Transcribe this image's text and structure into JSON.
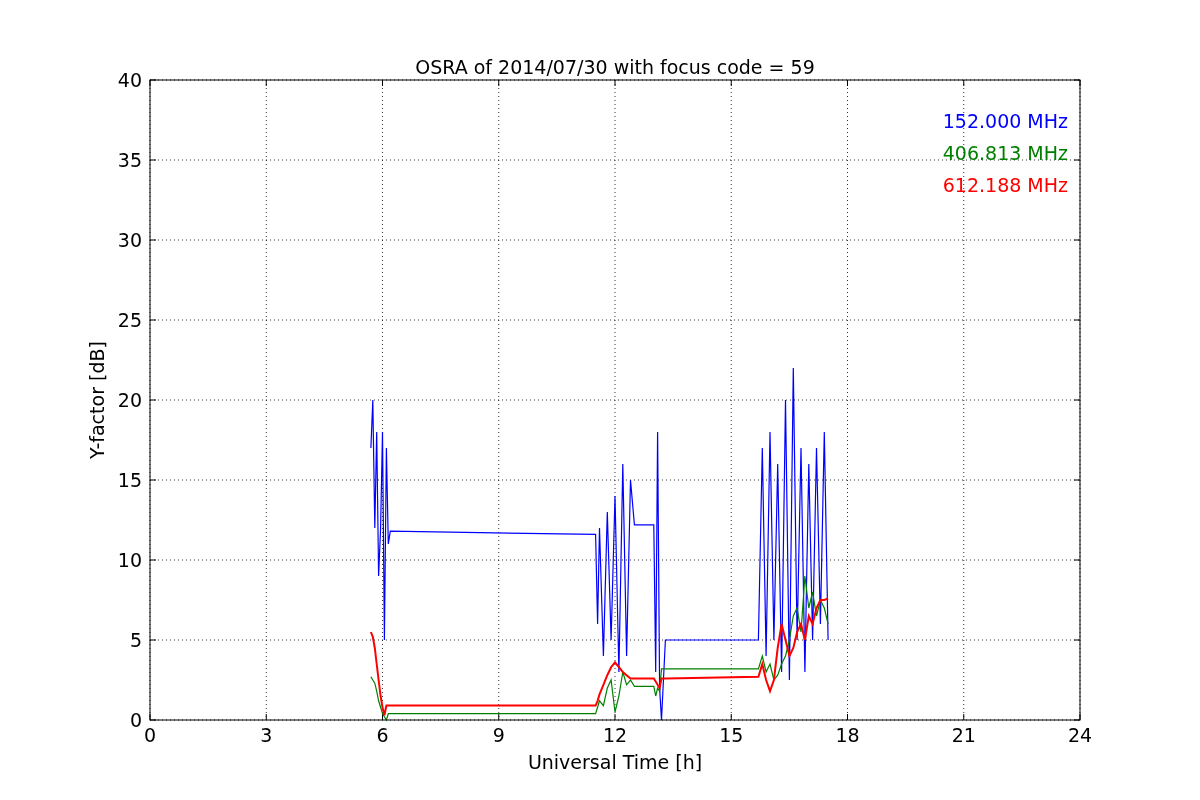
{
  "chart_data": {
    "type": "line",
    "title": "OSRA of 2014/07/30 with focus code = 59",
    "xlabel": "Universal Time [h]",
    "ylabel": "Y-factor [dB]",
    "x": [
      5.7,
      5.75,
      5.8,
      5.85,
      5.9,
      5.95,
      6.0,
      6.05,
      6.1,
      6.15,
      6.2,
      11.5,
      11.55,
      11.6,
      11.7,
      11.8,
      11.9,
      12.0,
      12.1,
      12.2,
      12.3,
      12.4,
      12.5,
      13.0,
      13.05,
      13.1,
      13.15,
      13.2,
      13.3,
      15.7,
      15.8,
      15.9,
      16.0,
      16.1,
      16.2,
      16.3,
      16.4,
      16.5,
      16.6,
      16.7,
      16.8,
      16.9,
      17.0,
      17.1,
      17.2,
      17.3,
      17.4,
      17.5
    ],
    "series": [
      {
        "name": "152.000 MHz",
        "color": "#0000ff",
        "values": [
          17,
          20,
          12,
          18,
          9,
          12,
          18,
          5,
          17,
          11,
          11.8,
          11.6,
          6,
          12,
          4,
          13,
          5,
          14,
          3,
          16,
          4,
          15,
          12.2,
          12.2,
          3,
          18,
          2,
          0,
          5,
          5,
          17,
          4,
          18,
          5,
          16,
          3,
          20,
          2.5,
          22,
          5,
          17,
          3,
          16,
          5,
          17,
          6,
          18,
          5
        ]
      },
      {
        "name": "406.813 MHz",
        "color": "#008000",
        "values": [
          2.7,
          2.5,
          2.3,
          1.8,
          1.2,
          0.8,
          0.4,
          0.2,
          0,
          0.4,
          0.4,
          0.4,
          0.8,
          1.2,
          0.9,
          2.0,
          2.5,
          0.5,
          1.5,
          3.0,
          2.2,
          2.5,
          2.1,
          2.1,
          1.5,
          2.0,
          1.8,
          3.2,
          3.2,
          3.2,
          4.0,
          3.0,
          3.5,
          2.5,
          2.8,
          3.5,
          4.0,
          5.0,
          6.5,
          7.0,
          5.5,
          9.0,
          7.0,
          8.0,
          6.5,
          7.5,
          7.0,
          6.0
        ]
      },
      {
        "name": "612.188 MHz",
        "color": "#ff0000",
        "values": [
          5.5,
          5.2,
          4.5,
          3.5,
          2.5,
          1.5,
          0.8,
          0.3,
          0.9,
          0.9,
          0.9,
          0.9,
          1.2,
          1.6,
          2.2,
          2.8,
          3.3,
          3.6,
          3.3,
          3.0,
          2.8,
          2.6,
          2.6,
          2.6,
          2.4,
          2.2,
          2.0,
          2.6,
          2.6,
          2.7,
          3.5,
          2.5,
          1.8,
          2.5,
          4.5,
          6.0,
          5.0,
          4.0,
          4.5,
          5.5,
          6.0,
          5.0,
          6.5,
          6.0,
          7.0,
          7.5,
          7.5,
          7.6
        ]
      }
    ],
    "grid": true,
    "xlim": [
      0,
      24
    ],
    "ylim": [
      0,
      40
    ],
    "xticks": [
      0,
      3,
      6,
      9,
      12,
      15,
      18,
      21,
      24
    ],
    "yticks": [
      0,
      5,
      10,
      15,
      20,
      25,
      30,
      35,
      40
    ]
  }
}
